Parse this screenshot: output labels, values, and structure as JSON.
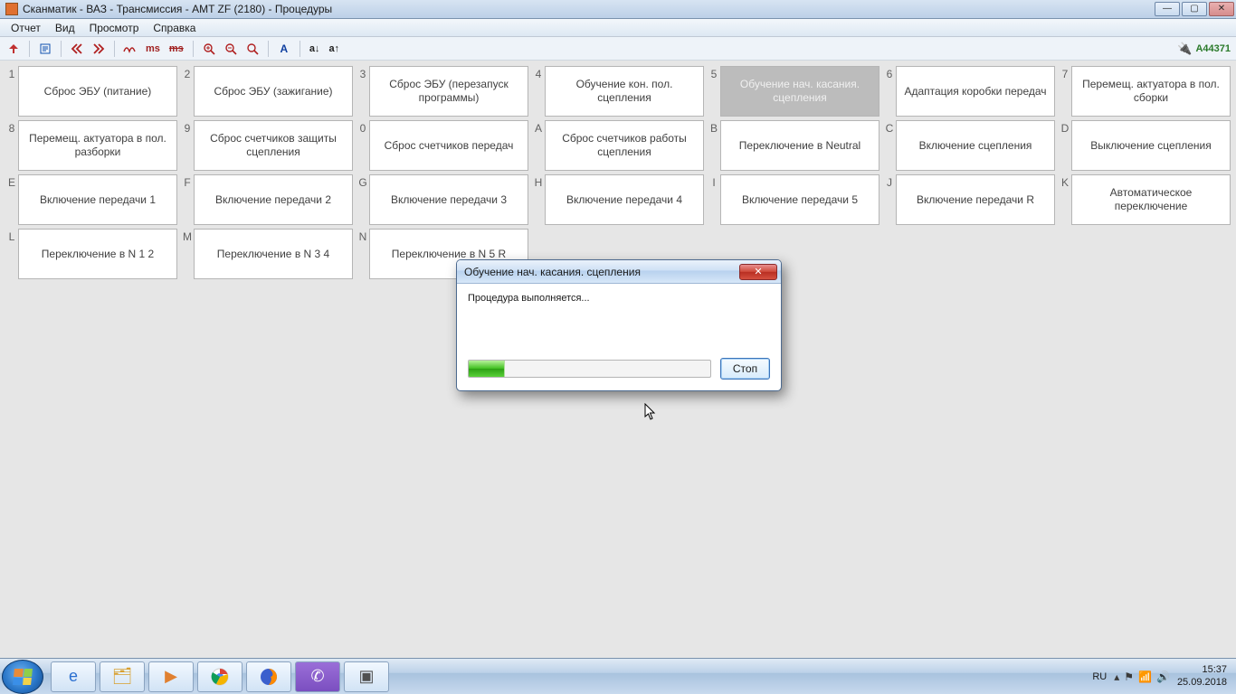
{
  "window_title": "Сканматик - ВАЗ - Трансмиссия - AMT ZF (2180) - Процедуры",
  "menu": {
    "report": "Отчет",
    "view": "Вид",
    "preview": "Просмотр",
    "help": "Справка"
  },
  "status_code": "A44371",
  "procedures": [
    {
      "key": "1",
      "label": "Сброс ЭБУ (питание)"
    },
    {
      "key": "2",
      "label": "Сброс ЭБУ (зажигание)"
    },
    {
      "key": "3",
      "label": "Сброс ЭБУ (перезапуск программы)"
    },
    {
      "key": "4",
      "label": "Обучение кон. пол. сцепления"
    },
    {
      "key": "5",
      "label": "Обучение нач. касания. сцепления",
      "active": true
    },
    {
      "key": "6",
      "label": "Адаптация коробки передач"
    },
    {
      "key": "7",
      "label": "Перемещ. актуатора в пол. сборки"
    },
    {
      "key": "8",
      "label": "Перемещ. актуатора в пол. разборки"
    },
    {
      "key": "9",
      "label": "Сброс счетчиков защиты сцепления"
    },
    {
      "key": "0",
      "label": "Сброс счетчиков передач"
    },
    {
      "key": "A",
      "label": "Сброс счетчиков работы сцепления"
    },
    {
      "key": "B",
      "label": "Переключение в Neutral"
    },
    {
      "key": "C",
      "label": "Включение сцепления"
    },
    {
      "key": "D",
      "label": "Выключение сцепления"
    },
    {
      "key": "E",
      "label": "Включение передачи 1"
    },
    {
      "key": "F",
      "label": "Включение передачи 2"
    },
    {
      "key": "G",
      "label": "Включение передачи 3"
    },
    {
      "key": "H",
      "label": "Включение передачи 4"
    },
    {
      "key": "I",
      "label": "Включение передачи 5"
    },
    {
      "key": "J",
      "label": "Включение передачи R"
    },
    {
      "key": "K",
      "label": "Автоматическое переключение"
    },
    {
      "key": "L",
      "label": "Переключение в N 1 2"
    },
    {
      "key": "M",
      "label": "Переключение в N 3 4"
    },
    {
      "key": "N",
      "label": "Переключение в N 5 R"
    }
  ],
  "dialog": {
    "title": "Обучение нач. касания. сцепления",
    "message": "Процедура выполняется...",
    "stop_label": "Стоп",
    "close_label": "✕"
  },
  "tray": {
    "lang": "RU",
    "time": "15:37",
    "date": "25.09.2018"
  },
  "toolbar_labels": {
    "ms": "ms",
    "ms2": "ms",
    "a_down": "a↓",
    "a_up": "a↑"
  }
}
